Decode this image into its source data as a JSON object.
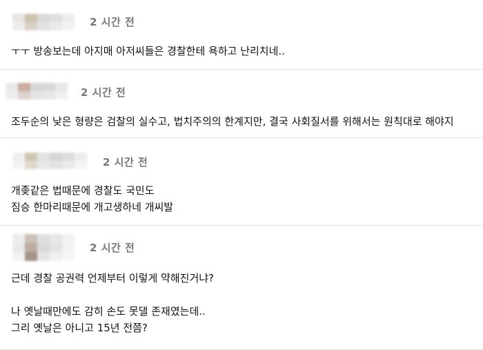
{
  "comments": [
    {
      "time": "2 시간 전",
      "lines": [
        "ㅜㅜ 방송보는데 아지매 아저씨들은 경찰한테 욕하고 난리치네.."
      ]
    },
    {
      "time": "2 시간 전",
      "lines": [
        "조두순의 낮은 형량은 검찰의 실수고, 법치주의의 한계지만, 결국 사회질서를 위해서는 원칙대로 해야지"
      ]
    },
    {
      "time": "2 시간 전",
      "lines": [
        "개좆같은 법때문에 경찰도 국민도",
        "짐승 한마리때문에 개고생하네 개씨발"
      ]
    },
    {
      "time": "2 시간 전",
      "lines": [
        "근데 경찰 공권력 언제부터 이렇게 약해진거냐?",
        "",
        "나 옛날때만에도 감히 손도 못댈 존재였는데..",
        "그리 옛날은 아니고 15년 전쯤?"
      ]
    }
  ],
  "colors": {
    "divider": "#e4e4e4",
    "time": "#777777",
    "text": "#111111"
  }
}
